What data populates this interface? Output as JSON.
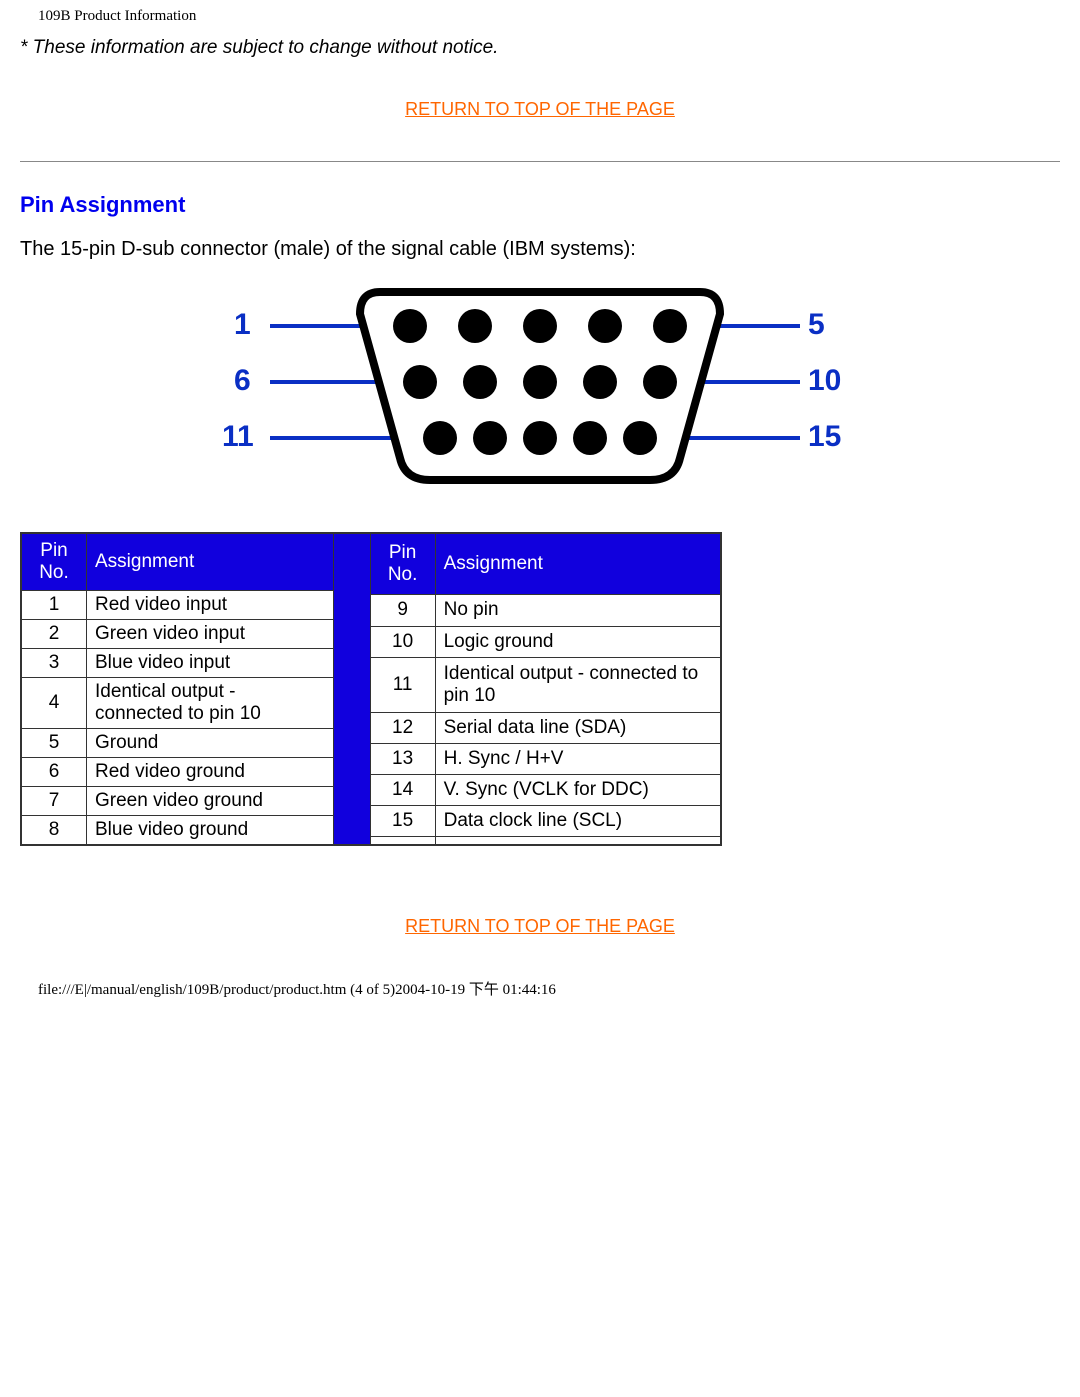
{
  "header_title": "109B Product Information",
  "notice": "* These information are subject to change without notice.",
  "return_link": "RETURN TO TOP OF THE PAGE",
  "section": {
    "title": "Pin Assignment",
    "intro": "The 15-pin D-sub connector (male) of the signal cable (IBM systems):"
  },
  "diagram_labels": {
    "l1": "1",
    "r1": "5",
    "l2": "6",
    "r2": "10",
    "l3": "11",
    "r3": "15"
  },
  "table": {
    "head_pin": "Pin No.",
    "head_assign": "Assignment",
    "left": [
      {
        "pin": "1",
        "assign": "Red video input"
      },
      {
        "pin": "2",
        "assign": "Green video input"
      },
      {
        "pin": "3",
        "assign": "Blue video input"
      },
      {
        "pin": "4",
        "assign": "Identical output - connected to pin 10"
      },
      {
        "pin": "5",
        "assign": "Ground"
      },
      {
        "pin": "6",
        "assign": "Red video ground"
      },
      {
        "pin": "7",
        "assign": "Green video ground"
      },
      {
        "pin": "8",
        "assign": "Blue video ground"
      }
    ],
    "right": [
      {
        "pin": "9",
        "assign": "No pin"
      },
      {
        "pin": "10",
        "assign": "Logic ground"
      },
      {
        "pin": "11",
        "assign": "Identical output - connected to pin 10"
      },
      {
        "pin": "12",
        "assign": "Serial data line (SDA)"
      },
      {
        "pin": "13",
        "assign": "H. Sync / H+V"
      },
      {
        "pin": "14",
        "assign": "V. Sync (VCLK for DDC)"
      },
      {
        "pin": "15",
        "assign": "Data clock line (SCL)"
      },
      {
        "pin": "",
        "assign": ""
      }
    ]
  },
  "footer": "file:///E|/manual/english/109B/product/product.htm (4 of 5)2004-10-19 下午 01:44:16"
}
